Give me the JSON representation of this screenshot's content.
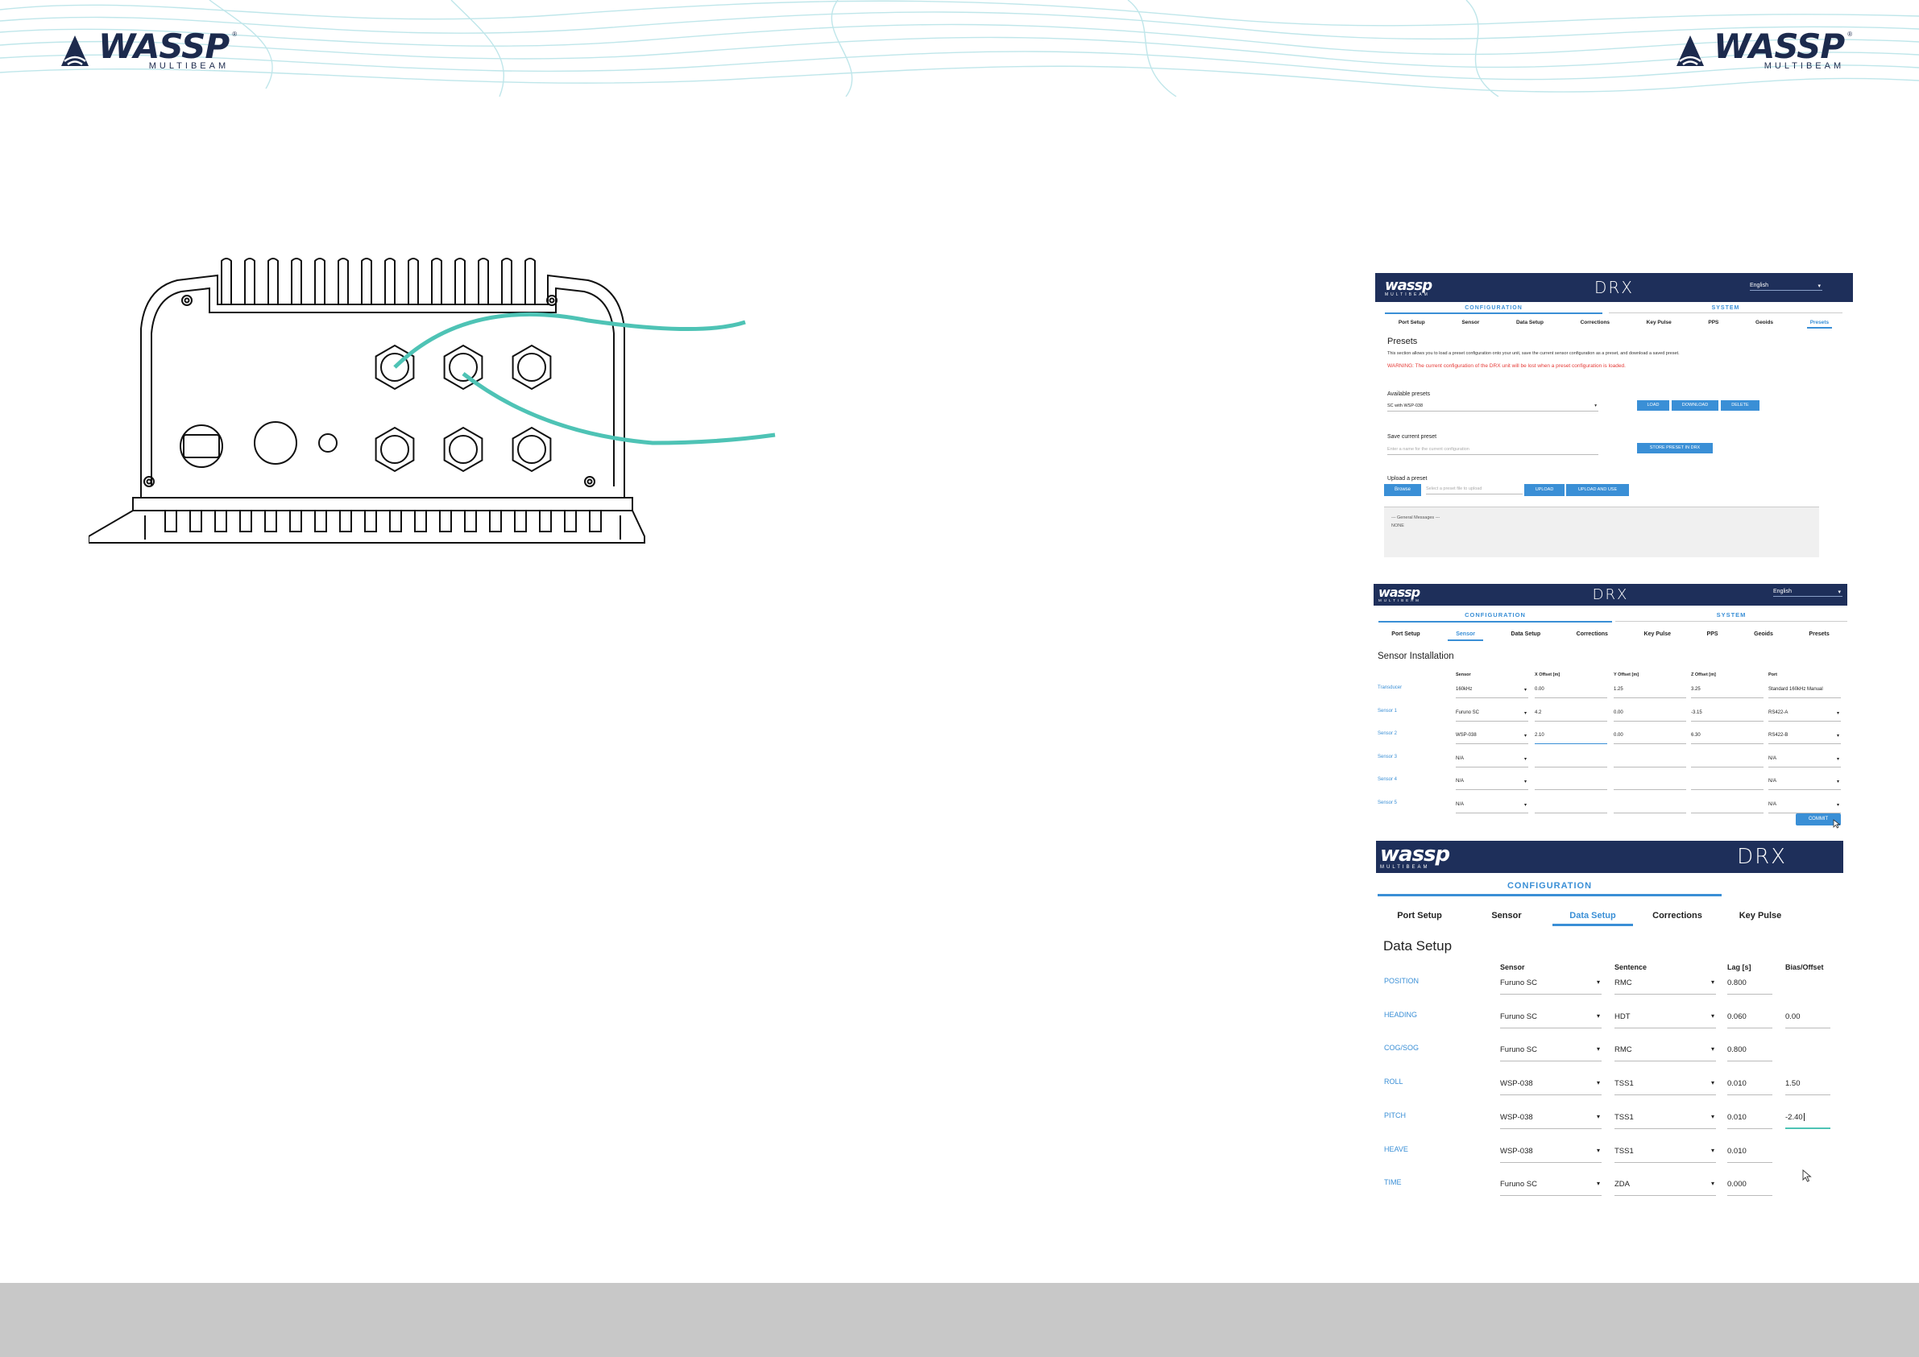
{
  "brand": {
    "name": "WASSP",
    "tagline": "MULTIBEAM",
    "reg": "®"
  },
  "colors": {
    "navy": "#1e2f5a",
    "accent": "#3a8fd6",
    "cable": "#4ec3b5",
    "warning": "#e53935",
    "footer": "#c8c8c8"
  },
  "presets_panel": {
    "logo": "wassp",
    "logo_sub": "MULTIBEAM",
    "product": "DRX",
    "language": "English",
    "section_config": "CONFIGURATION",
    "section_system": "SYSTEM",
    "tabs": [
      "Port Setup",
      "Sensor",
      "Data Setup",
      "Corrections",
      "Key Pulse",
      "PPS",
      "Geoids",
      "Presets"
    ],
    "active_tab": "Presets",
    "title": "Presets",
    "description": "This section allows you to load a preset configuration onto your unit, save the current sensor configuration as a preset, and download a saved preset.",
    "warning": "WARNING: The current configuration of the DRX unit will be lost when a preset configuration is loaded.",
    "available_label": "Available presets",
    "available_value": "SC with WSP-038",
    "load_button": "LOAD",
    "download_button": "DOWNLOAD",
    "delete_button": "DELETE",
    "save_label": "Save current preset",
    "save_placeholder": "Enter a name for the current configuration",
    "store_button": "STORE PRESET IN DRX",
    "upload_label": "Upload a preset",
    "browse_button": "Browse",
    "upload_placeholder": "Select a preset file to upload",
    "upload_button": "UPLOAD",
    "upload_use_button": "UPLOAD AND USE",
    "messages_title": "--- General Messages ---",
    "messages_value": "NONE"
  },
  "sensor_panel": {
    "logo": "wassp",
    "logo_sub": "MULTIBEAM",
    "product": "DRX",
    "language": "English",
    "section_config": "CONFIGURATION",
    "section_system": "SYSTEM",
    "tabs": [
      "Port Setup",
      "Sensor",
      "Data Setup",
      "Corrections",
      "Key Pulse",
      "PPS",
      "Geoids",
      "Presets"
    ],
    "active_tab": "Sensor",
    "title": "Sensor Installation",
    "columns": [
      "Sensor",
      "X Offset [m]",
      "Y Offset [m]",
      "Z Offset [m]",
      "Port"
    ],
    "commit_button": "COMMIT",
    "rows": [
      {
        "label": "Transducer",
        "sensor": "160kHz",
        "x": "0.00",
        "y": "1.25",
        "z": "3.25",
        "port": "Standard 160kHz Manual",
        "port_dropdown": false
      },
      {
        "label": "Sensor 1",
        "sensor": "Furuno SC",
        "x": "4.2",
        "y": "0.00",
        "z": "-3.15",
        "port": "RS422-A",
        "port_dropdown": true
      },
      {
        "label": "Sensor 2",
        "sensor": "WSP-038",
        "x": "2.10",
        "y": "0.00",
        "z": "6.30",
        "port": "RS422-B",
        "port_dropdown": true
      },
      {
        "label": "Sensor 3",
        "sensor": "N/A",
        "x": "",
        "y": "",
        "z": "",
        "port": "N/A",
        "port_dropdown": true
      },
      {
        "label": "Sensor 4",
        "sensor": "N/A",
        "x": "",
        "y": "",
        "z": "",
        "port": "N/A",
        "port_dropdown": true
      },
      {
        "label": "Sensor 5",
        "sensor": "N/A",
        "x": "",
        "y": "",
        "z": "",
        "port": "N/A",
        "port_dropdown": true
      }
    ]
  },
  "data_panel": {
    "logo": "wassp",
    "logo_sub": "MULTIBEAM",
    "product": "DRX",
    "section_config": "CONFIGURATION",
    "tabs": [
      "Port Setup",
      "Sensor",
      "Data Setup",
      "Corrections",
      "Key Pulse"
    ],
    "active_tab": "Data Setup",
    "title": "Data Setup",
    "columns": [
      "Sensor",
      "Sentence",
      "Lag [s]",
      "Bias/Offset"
    ],
    "rows": [
      {
        "label": "POSITION",
        "sensor": "Furuno SC",
        "sentence": "RMC",
        "lag": "0.800",
        "bias": null
      },
      {
        "label": "HEADING",
        "sensor": "Furuno SC",
        "sentence": "HDT",
        "lag": "0.060",
        "bias": "0.00"
      },
      {
        "label": "COG/SOG",
        "sensor": "Furuno SC",
        "sentence": "RMC",
        "lag": "0.800",
        "bias": null
      },
      {
        "label": "ROLL",
        "sensor": "WSP-038",
        "sentence": "TSS1",
        "lag": "0.010",
        "bias": "1.50"
      },
      {
        "label": "PITCH",
        "sensor": "WSP-038",
        "sentence": "TSS1",
        "lag": "0.010",
        "bias": "-2.40"
      },
      {
        "label": "HEAVE",
        "sensor": "WSP-038",
        "sentence": "TSS1",
        "lag": "0.010",
        "bias": null
      },
      {
        "label": "TIME",
        "sensor": "Furuno SC",
        "sentence": "ZDA",
        "lag": "0.000",
        "bias": null
      }
    ]
  }
}
